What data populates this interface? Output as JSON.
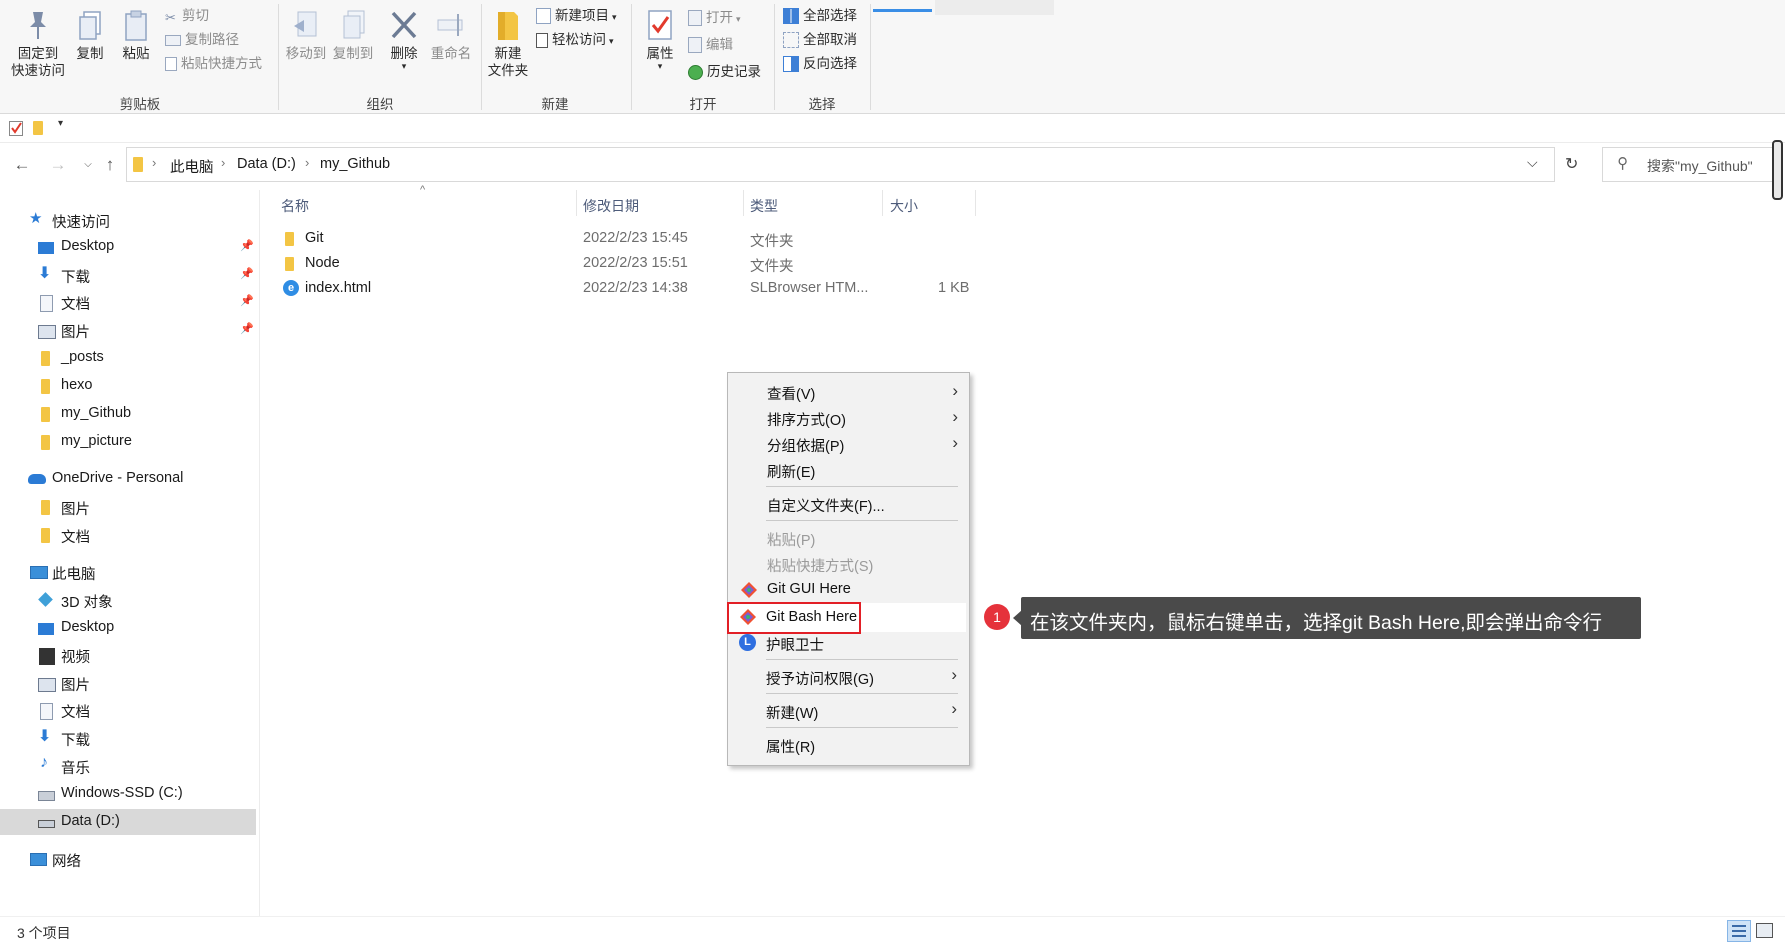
{
  "ribbon": {
    "clipboard": {
      "pin_label_1": "固定到",
      "pin_label_2": "快速访问",
      "copy": "复制",
      "paste": "粘贴",
      "cut": "剪切",
      "copy_path": "复制路径",
      "paste_shortcut": "粘贴快捷方式",
      "group": "剪贴板"
    },
    "organize": {
      "move_to": "移动到",
      "copy_to": "复制到",
      "delete": "删除",
      "rename": "重命名",
      "group": "组织"
    },
    "new": {
      "new_folder_1": "新建",
      "new_folder_2": "文件夹",
      "new_item": "新建项目",
      "easy_access": "轻松访问",
      "group": "新建"
    },
    "open": {
      "properties": "属性",
      "open": "打开",
      "edit": "编辑",
      "history": "历史记录",
      "group": "打开"
    },
    "select": {
      "select_all": "全部选择",
      "select_none": "全部取消",
      "invert": "反向选择",
      "group": "选择"
    }
  },
  "address": {
    "crumbs": [
      "此电脑",
      "Data (D:)",
      "my_Github"
    ],
    "search_placeholder": "搜索\"my_Github\""
  },
  "sidebar": {
    "quick_access": "快速访问",
    "quick_items": [
      "Desktop",
      "下载",
      "文档",
      "图片",
      "_posts",
      "hexo",
      "my_Github",
      "my_picture"
    ],
    "onedrive": "OneDrive - Personal",
    "onedrive_items": [
      "图片",
      "文档"
    ],
    "this_pc": "此电脑",
    "pc_items": [
      "3D 对象",
      "Desktop",
      "视频",
      "图片",
      "文档",
      "下载",
      "音乐",
      "Windows-SSD (C:)",
      "Data (D:)"
    ],
    "network": "网络"
  },
  "columns": {
    "name": "名称",
    "date": "修改日期",
    "type": "类型",
    "size": "大小"
  },
  "files": [
    {
      "name": "Git",
      "date": "2022/2/23 15:45",
      "type": "文件夹",
      "size": ""
    },
    {
      "name": "Node",
      "date": "2022/2/23 15:51",
      "type": "文件夹",
      "size": ""
    },
    {
      "name": "index.html",
      "date": "2022/2/23 14:38",
      "type": "SLBrowser HTM...",
      "size": "1 KB"
    }
  ],
  "context_menu": {
    "view": "查看(V)",
    "sort": "排序方式(O)",
    "group_by": "分组依据(P)",
    "refresh": "刷新(E)",
    "customize": "自定义文件夹(F)...",
    "paste": "粘贴(P)",
    "paste_shortcut": "粘贴快捷方式(S)",
    "git_gui": "Git GUI Here",
    "git_bash": "Git Bash Here",
    "eye_guard": "护眼卫士",
    "grant_access": "授予访问权限(G)",
    "new": "新建(W)",
    "properties": "属性(R)"
  },
  "annotation": {
    "badge": "1",
    "text": "在该文件夹内，鼠标右键单击，选择git Bash Here,即会弹出命令行"
  },
  "status": {
    "count": "3 个项目"
  },
  "colors": {
    "accent": "#0078d7",
    "folder": "#f3c544",
    "highlight": "#e21f26",
    "callout": "#4a4a4a"
  }
}
